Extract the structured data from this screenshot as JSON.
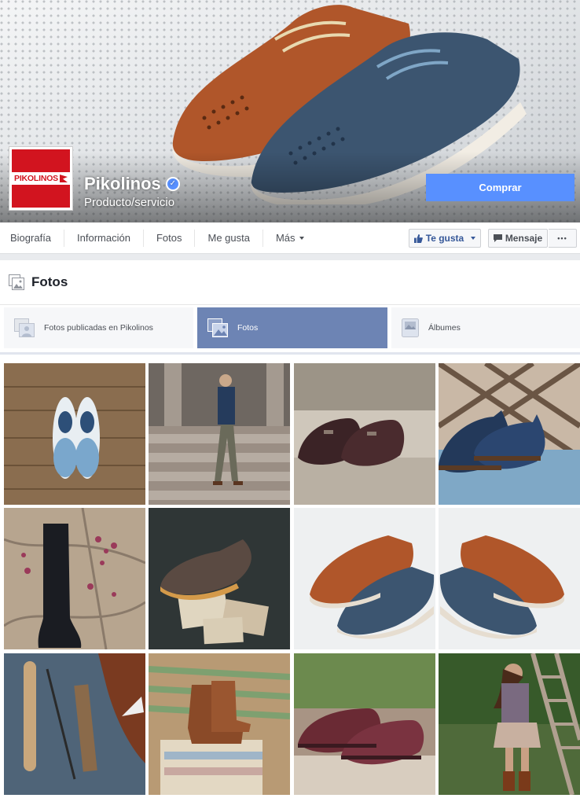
{
  "page": {
    "name": "Pikolinos",
    "category": "Producto/servicio",
    "logo_text": "PIKOLINOS",
    "verified_icon": "check-icon",
    "cta_label": "Comprar"
  },
  "nav": {
    "items": [
      "Biografía",
      "Información",
      "Fotos",
      "Me gusta",
      "Más"
    ],
    "like_label": "Te gusta",
    "message_label": "Mensaje",
    "more_label": "•••"
  },
  "photos": {
    "title": "Fotos",
    "tabs": [
      "Fotos publicadas en Pikolinos",
      "Fotos",
      "Álbumes"
    ],
    "selected_tab": "Fotos"
  },
  "colors": {
    "brand_red": "#d2141f",
    "facebook_blue": "#5890ff",
    "selected_tab": "#6d84b4",
    "link_blue": "#365899"
  },
  "grid": [
    {
      "name": "photo-white-blue-shoes"
    },
    {
      "name": "photo-man-on-steps"
    },
    {
      "name": "photo-dark-monk-shoes"
    },
    {
      "name": "photo-blue-boots-lattice"
    },
    {
      "name": "photo-tall-black-boot"
    },
    {
      "name": "photo-brown-shoe-postcards"
    },
    {
      "name": "photo-brown-blue-shoes"
    },
    {
      "name": "photo-brown-blue-shoes-mirror"
    },
    {
      "name": "photo-leather-tools"
    },
    {
      "name": "photo-boots-on-chair"
    },
    {
      "name": "photo-burgundy-shoes"
    },
    {
      "name": "photo-woman-on-ladder"
    }
  ]
}
